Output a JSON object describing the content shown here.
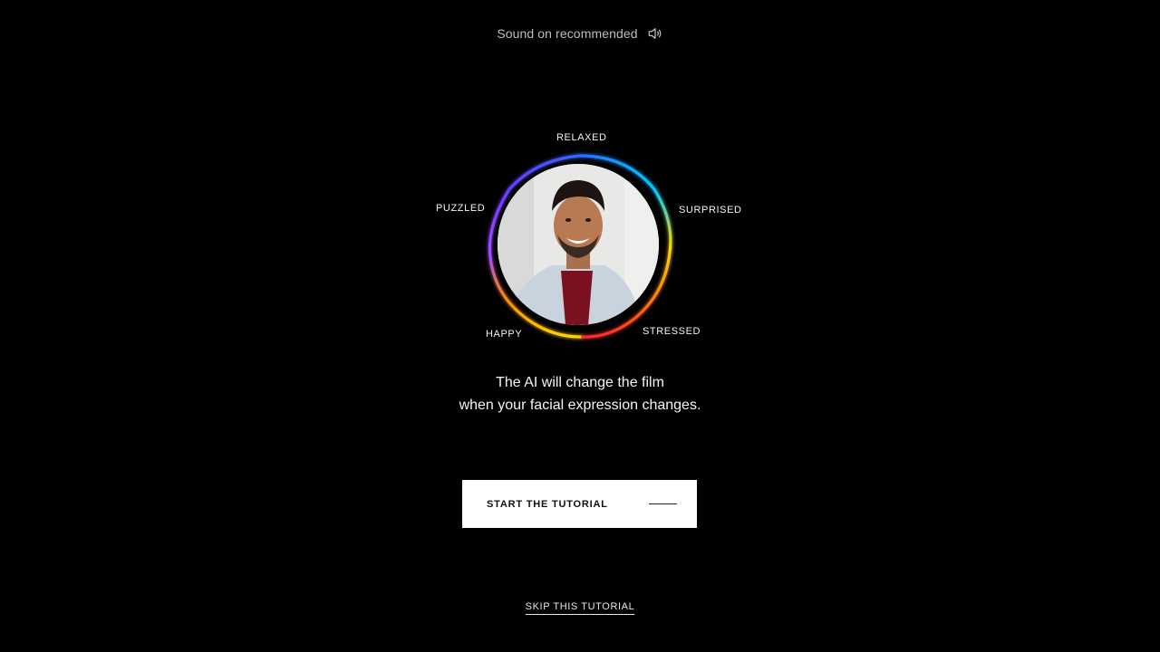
{
  "header": {
    "sound_text": "Sound on recommended",
    "sound_icon": "speaker-sound-icon"
  },
  "emotions": {
    "top": "RELAXED",
    "right": "SURPRISED",
    "left": "PUZZLED",
    "bottom_left": "HAPPY",
    "bottom_right": "STRESSED"
  },
  "ring_colors": [
    "#3b5bff",
    "#00c8ff",
    "#ffd400",
    "#ff8a00",
    "#ff2a2a",
    "#8a3bff"
  ],
  "photo": {
    "description_icon": "smiling-man-portrait"
  },
  "caption": {
    "line1": "The AI will change the film",
    "line2": "when your facial expression changes."
  },
  "actions": {
    "start_label": "START THE TUTORIAL",
    "skip_label": "SKIP THIS TUTORIAL"
  }
}
